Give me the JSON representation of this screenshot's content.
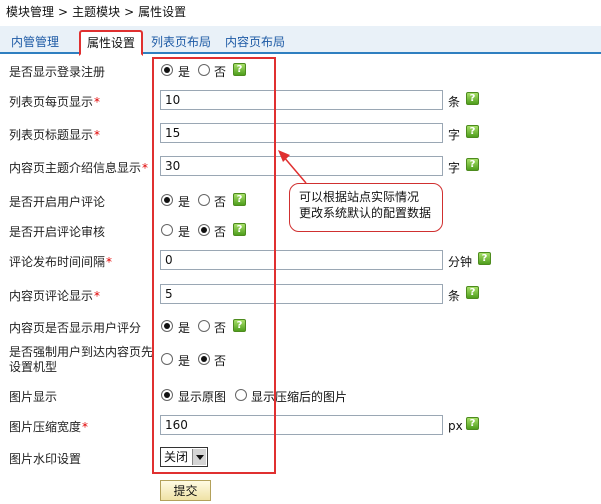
{
  "breadcrumb": [
    "模块管理",
    "主题模块",
    "属性设置"
  ],
  "breadcrumb_sep": ">",
  "tabs": [
    "内管管理",
    "属性设置",
    "列表页布局",
    "内容页布局"
  ],
  "active_tab": 1,
  "radio": {
    "yes": "是",
    "no": "否"
  },
  "help_glyph": "?",
  "fields": {
    "show_login": {
      "label": "是否显示登录注册",
      "selected": "yes"
    },
    "list_per_page": {
      "label": "列表页每页显示",
      "value": "10",
      "unit": "条"
    },
    "list_title_len": {
      "label": "列表页标题显示",
      "value": "15",
      "unit": "字"
    },
    "content_intro_len": {
      "label": "内容页主题介绍信息显示",
      "value": "30",
      "unit": "字"
    },
    "enable_comment": {
      "label": "是否开启用户评论",
      "selected": "yes"
    },
    "comment_review": {
      "label": "是否开启评论审核",
      "selected": "no"
    },
    "comment_interval": {
      "label": "评论发布时间间隔",
      "value": "0",
      "unit": "分钟"
    },
    "content_comment_count": {
      "label": "内容页评论显示",
      "value": "5",
      "unit": "条"
    },
    "show_rating": {
      "label": "内容页是否显示用户评分",
      "selected": "yes"
    },
    "force_mechanism": {
      "label": "是否强制用户到达内容页先设置机型",
      "selected": "no"
    },
    "image_display": {
      "label": "图片显示",
      "options": [
        "显示原图",
        "显示压缩后的图片"
      ],
      "selected": 0
    },
    "image_width": {
      "label": "图片压缩宽度",
      "value": "160",
      "unit": "px"
    },
    "watermark": {
      "label": "图片水印设置",
      "value": "关闭"
    }
  },
  "required_mark": "*",
  "submit_label": "提交",
  "annotation": {
    "line1": "可以根据站点实际情况",
    "line2": "更改系统默认的配置数据"
  },
  "colors": {
    "annotation": "#e03030",
    "tab_text": "#1d5aa5",
    "tab_underline": "#2f7fc0",
    "help_green": "#4f9e1c"
  }
}
